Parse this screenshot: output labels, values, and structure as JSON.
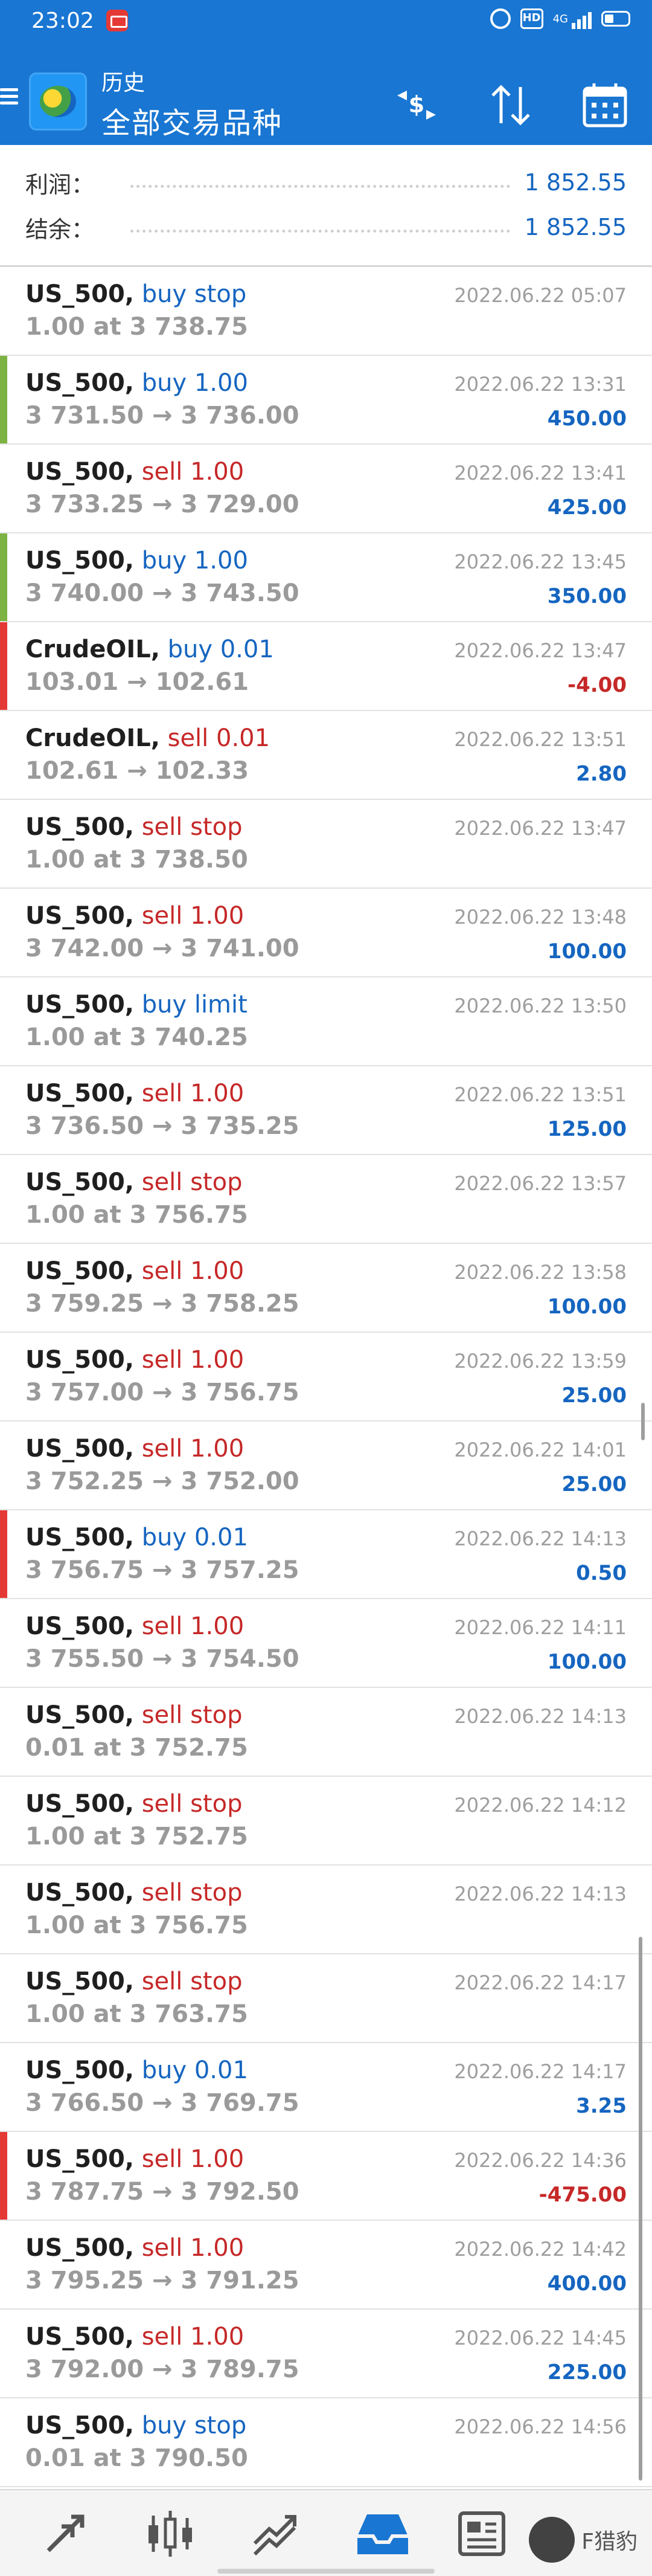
{
  "status_bar": {
    "time": "23:02",
    "network": "4G"
  },
  "header": {
    "subtitle": "历史",
    "title": "全部交易品种"
  },
  "summary": {
    "profit_label": "利润：",
    "profit_value": "1 852.55",
    "balance_label": "结余：",
    "balance_value": "1 852.55"
  },
  "colors": {
    "accent": "#1976d2",
    "buy": "#1565c0",
    "sell": "#c62828",
    "bar_green": "#7cb342",
    "bar_red": "#e53935"
  },
  "orders": [
    {
      "symbol": "US_500,",
      "action": " buy stop",
      "side": "buy",
      "detail": "1.00 at 3 738.75",
      "datetime": "2022.06.22 05:07",
      "profit": "",
      "bar": ""
    },
    {
      "symbol": "US_500,",
      "action": " buy 1.00",
      "side": "buy",
      "detail": "3 731.50 → 3 736.00",
      "datetime": "2022.06.22 13:31",
      "profit": "450.00",
      "bar": "green"
    },
    {
      "symbol": "US_500,",
      "action": " sell 1.00",
      "side": "sell",
      "detail": "3 733.25 → 3 729.00",
      "datetime": "2022.06.22 13:41",
      "profit": "425.00",
      "bar": ""
    },
    {
      "symbol": "US_500,",
      "action": " buy 1.00",
      "side": "buy",
      "detail": "3 740.00 → 3 743.50",
      "datetime": "2022.06.22 13:45",
      "profit": "350.00",
      "bar": "green"
    },
    {
      "symbol": "CrudeOIL,",
      "action": " buy 0.01",
      "side": "buy",
      "detail": "103.01 → 102.61",
      "datetime": "2022.06.22 13:47",
      "profit": "-4.00",
      "bar": "red"
    },
    {
      "symbol": "CrudeOIL,",
      "action": " sell 0.01",
      "side": "sell",
      "detail": "102.61 → 102.33",
      "datetime": "2022.06.22 13:51",
      "profit": "2.80",
      "bar": ""
    },
    {
      "symbol": "US_500,",
      "action": " sell stop",
      "side": "sell",
      "detail": "1.00 at 3 738.50",
      "datetime": "2022.06.22 13:47",
      "profit": "",
      "bar": ""
    },
    {
      "symbol": "US_500,",
      "action": " sell 1.00",
      "side": "sell",
      "detail": "3 742.00 → 3 741.00",
      "datetime": "2022.06.22 13:48",
      "profit": "100.00",
      "bar": ""
    },
    {
      "symbol": "US_500,",
      "action": " buy limit",
      "side": "buy",
      "detail": "1.00 at 3 740.25",
      "datetime": "2022.06.22 13:50",
      "profit": "",
      "bar": ""
    },
    {
      "symbol": "US_500,",
      "action": " sell 1.00",
      "side": "sell",
      "detail": "3 736.50 → 3 735.25",
      "datetime": "2022.06.22 13:51",
      "profit": "125.00",
      "bar": ""
    },
    {
      "symbol": "US_500,",
      "action": " sell stop",
      "side": "sell",
      "detail": "1.00 at 3 756.75",
      "datetime": "2022.06.22 13:57",
      "profit": "",
      "bar": ""
    },
    {
      "symbol": "US_500,",
      "action": " sell 1.00",
      "side": "sell",
      "detail": "3 759.25 → 3 758.25",
      "datetime": "2022.06.22 13:58",
      "profit": "100.00",
      "bar": ""
    },
    {
      "symbol": "US_500,",
      "action": " sell 1.00",
      "side": "sell",
      "detail": "3 757.00 → 3 756.75",
      "datetime": "2022.06.22 13:59",
      "profit": "25.00",
      "bar": ""
    },
    {
      "symbol": "US_500,",
      "action": " sell 1.00",
      "side": "sell",
      "detail": "3 752.25 → 3 752.00",
      "datetime": "2022.06.22 14:01",
      "profit": "25.00",
      "bar": ""
    },
    {
      "symbol": "US_500,",
      "action": " buy 0.01",
      "side": "buy",
      "detail": "3 756.75 → 3 757.25",
      "datetime": "2022.06.22 14:13",
      "profit": "0.50",
      "bar": "red"
    },
    {
      "symbol": "US_500,",
      "action": " sell 1.00",
      "side": "sell",
      "detail": "3 755.50 → 3 754.50",
      "datetime": "2022.06.22 14:11",
      "profit": "100.00",
      "bar": ""
    },
    {
      "symbol": "US_500,",
      "action": " sell stop",
      "side": "sell",
      "detail": "0.01 at 3 752.75",
      "datetime": "2022.06.22 14:13",
      "profit": "",
      "bar": ""
    },
    {
      "symbol": "US_500,",
      "action": " sell stop",
      "side": "sell",
      "detail": "1.00 at 3 752.75",
      "datetime": "2022.06.22 14:12",
      "profit": "",
      "bar": ""
    },
    {
      "symbol": "US_500,",
      "action": " sell stop",
      "side": "sell",
      "detail": "1.00 at 3 756.75",
      "datetime": "2022.06.22 14:13",
      "profit": "",
      "bar": ""
    },
    {
      "symbol": "US_500,",
      "action": " sell stop",
      "side": "sell",
      "detail": "1.00 at 3 763.75",
      "datetime": "2022.06.22 14:17",
      "profit": "",
      "bar": ""
    },
    {
      "symbol": "US_500,",
      "action": " buy 0.01",
      "side": "buy",
      "detail": "3 766.50 → 3 769.75",
      "datetime": "2022.06.22 14:17",
      "profit": "3.25",
      "bar": ""
    },
    {
      "symbol": "US_500,",
      "action": " sell 1.00",
      "side": "sell",
      "detail": "3 787.75 → 3 792.50",
      "datetime": "2022.06.22 14:36",
      "profit": "-475.00",
      "bar": "red"
    },
    {
      "symbol": "US_500,",
      "action": " sell 1.00",
      "side": "sell",
      "detail": "3 795.25 → 3 791.25",
      "datetime": "2022.06.22 14:42",
      "profit": "400.00",
      "bar": ""
    },
    {
      "symbol": "US_500,",
      "action": " sell 1.00",
      "side": "sell",
      "detail": "3 792.00 → 3 789.75",
      "datetime": "2022.06.22 14:45",
      "profit": "225.00",
      "bar": ""
    },
    {
      "symbol": "US_500,",
      "action": " buy stop",
      "side": "buy",
      "detail": "0.01 at 3 790.50",
      "datetime": "2022.06.22 14:56",
      "profit": "",
      "bar": ""
    }
  ],
  "bottom_nav": {
    "items": [
      "quotes",
      "chart",
      "trade",
      "history",
      "news"
    ],
    "active": "history",
    "watermark": "F猎豹"
  }
}
